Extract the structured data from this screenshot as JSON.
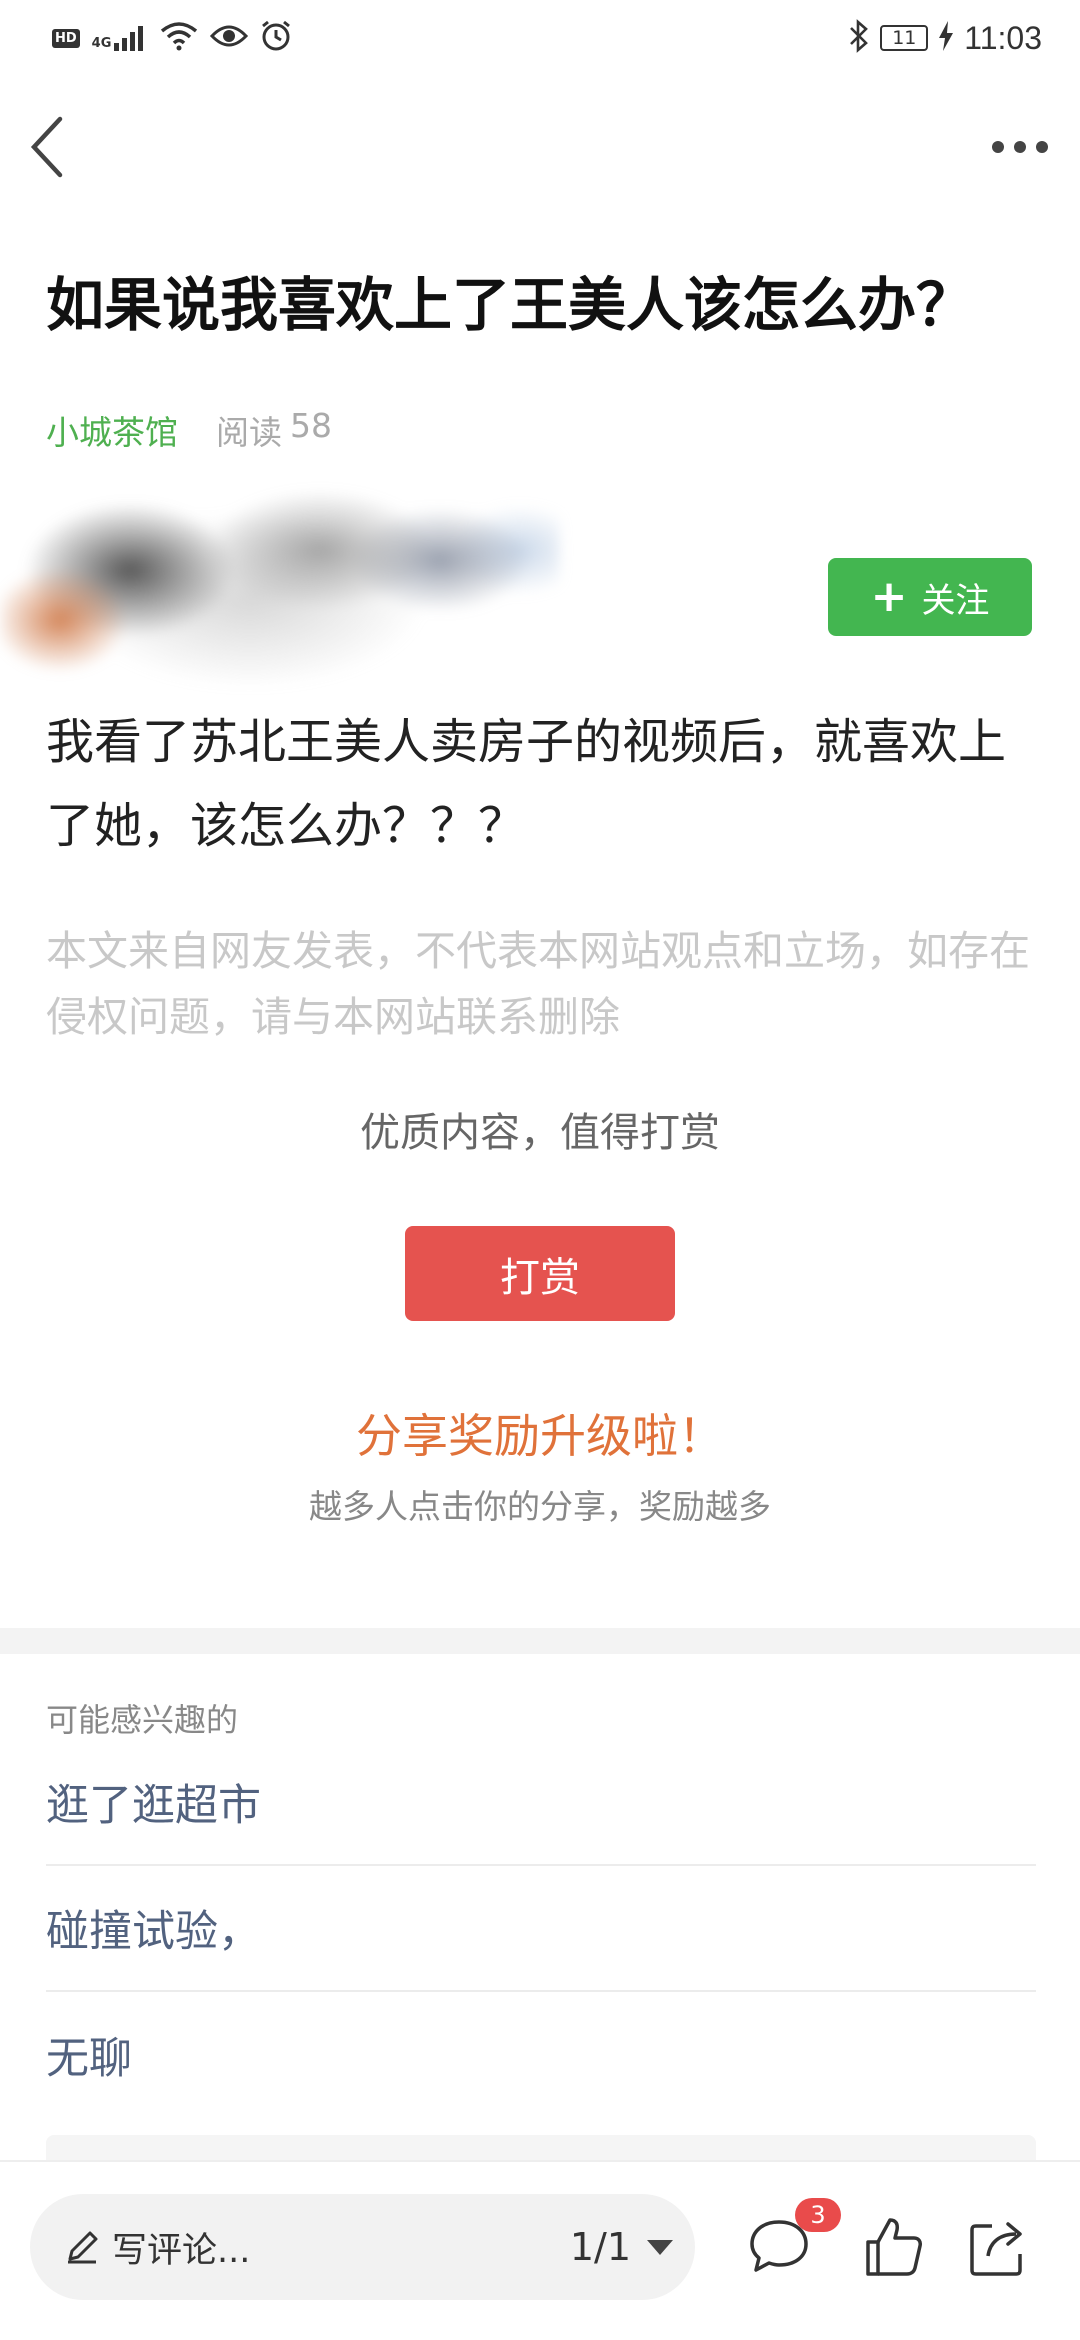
{
  "status_bar": {
    "left_icons": [
      "hd-icon",
      "4g-signal-icon",
      "wifi-icon",
      "eye-icon",
      "alarm-icon"
    ],
    "network_label": "4G",
    "hd_label": "HD",
    "battery_level": "11",
    "time": "11:03"
  },
  "nav": {
    "back_icon": "chevron-left-icon",
    "more_icon": "more-dots-icon"
  },
  "article": {
    "title": "如果说我喜欢上了王美人该怎么办？",
    "author": "小城茶馆",
    "reads_label": "阅读",
    "reads_count": "58",
    "follow_label": "关注",
    "body": "我看了苏北王美人卖房子的视频后，就喜欢上了她，该怎么办？？？",
    "disclaimer": "本文来自网友发表，不代表本网站观点和立场，如存在侵权问题，请与本网站联系删除"
  },
  "reward": {
    "prompt": "优质内容，值得打赏",
    "button_label": "打赏"
  },
  "share": {
    "title": "分享奖励升级啦！",
    "subtitle": "越多人点击你的分享，奖励越多"
  },
  "related": {
    "label": "可能感兴趣的",
    "items": [
      {
        "label": "逛了逛超市"
      },
      {
        "label": "碰撞试验，"
      },
      {
        "label": "无聊"
      }
    ]
  },
  "bottom_bar": {
    "comment_placeholder": "写评论...",
    "page_indicator": "1/1",
    "comment_count": "3"
  },
  "colors": {
    "accent_green": "#43b650",
    "reward_red": "#e5534f",
    "share_orange": "#e0723a",
    "link_blue_gray": "#52627f"
  }
}
